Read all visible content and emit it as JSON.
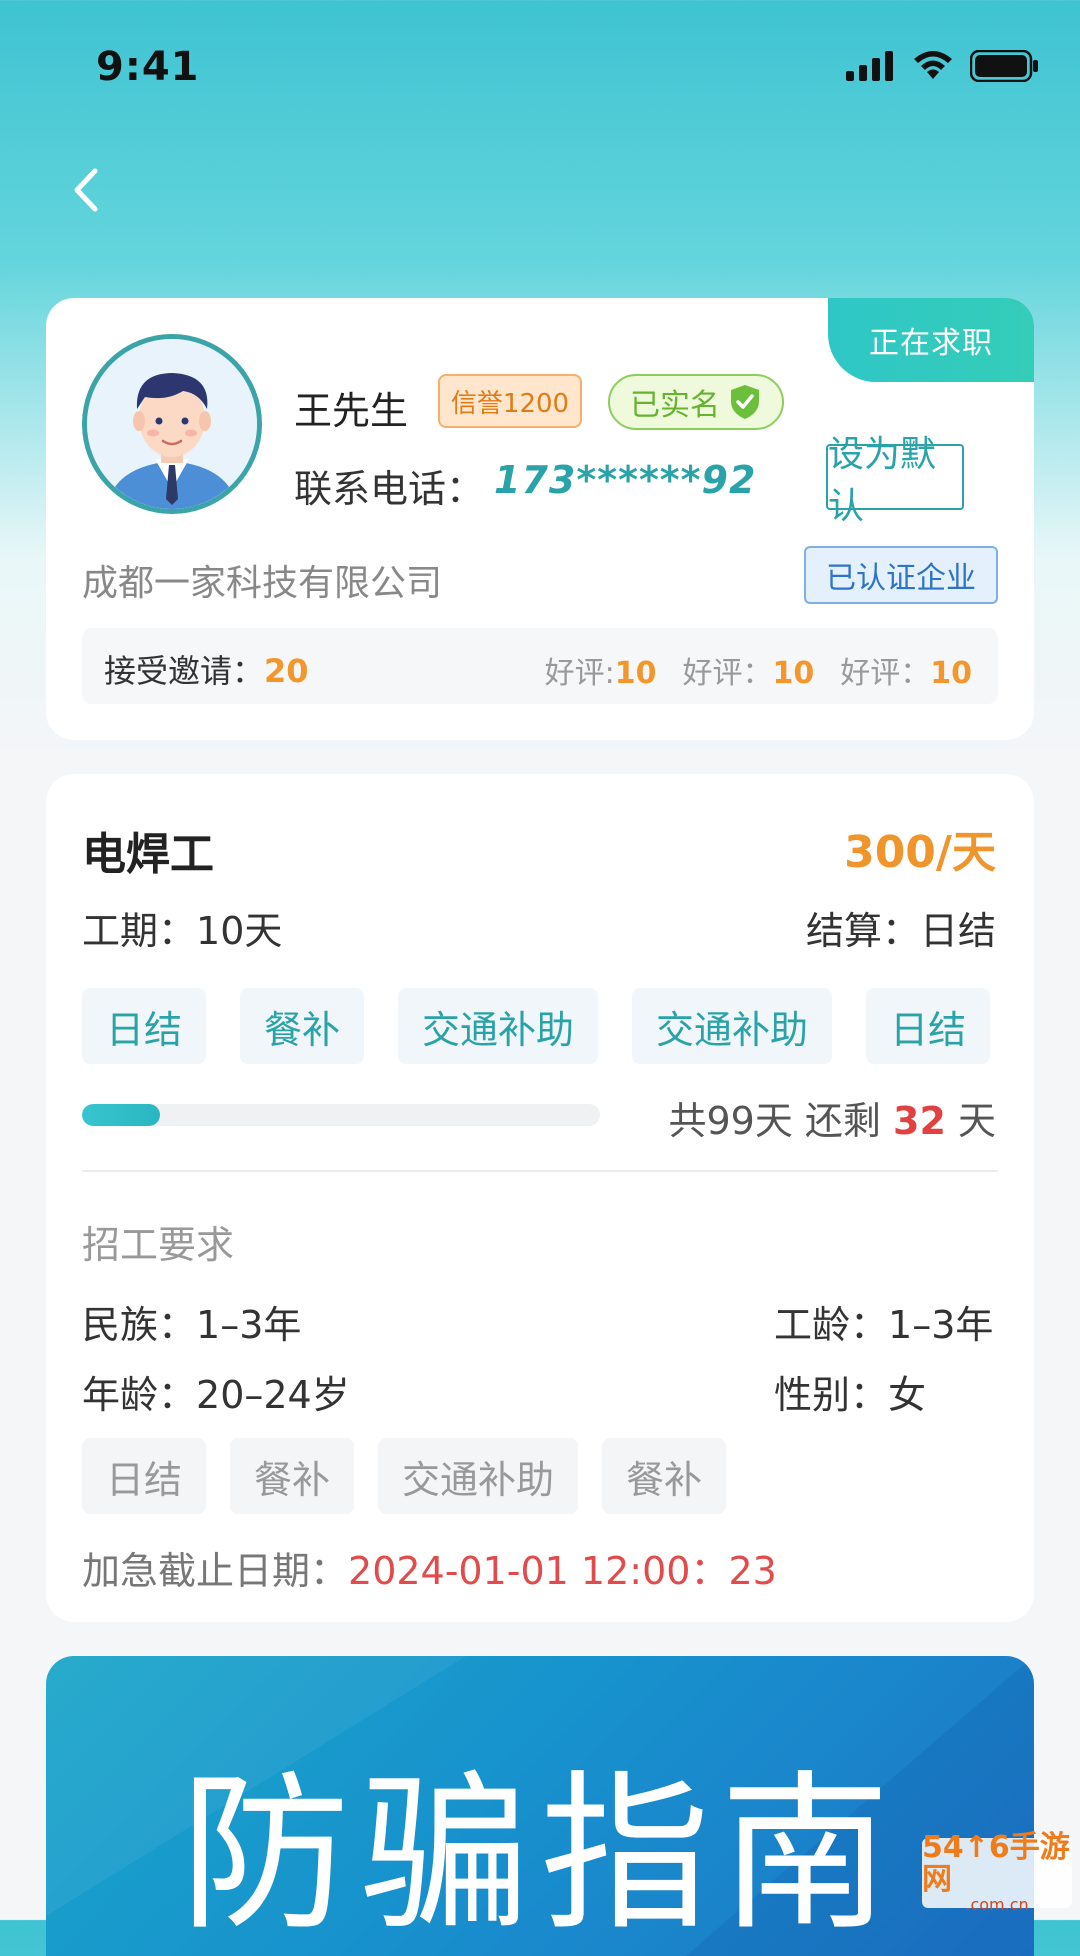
{
  "status_bar": {
    "time": "9:41"
  },
  "profile": {
    "status_tag": "正在求职",
    "name": "王先生",
    "credit_badge": "信誉1200",
    "verified_badge": "已实名",
    "phone_label": "联系电话：",
    "phone_value": "173******92",
    "default_button": "设为默认",
    "company": "成都一家科技有限公司",
    "company_badge": "已认证企业",
    "stats": {
      "accept_label": "接受邀请：",
      "accept_value": "20",
      "reviews": [
        {
          "label": "好评:",
          "value": "10"
        },
        {
          "label": "好评：",
          "value": "10"
        },
        {
          "label": "好评：",
          "value": "10"
        }
      ]
    }
  },
  "job": {
    "title": "电焊工",
    "wage": "300/天",
    "period_label": "工期：",
    "period_value": "10天",
    "settle_label": "结算：",
    "settle_value": "日结",
    "tags": [
      "日结",
      "餐补",
      "交通补助",
      "交通补助",
      "日结"
    ],
    "progress": {
      "fraction": 0.15,
      "total_text": "共99天 还剩 ",
      "remaining": "32",
      "unit": " 天"
    },
    "requirements_title": "招工要求",
    "requirements": {
      "ethnicity_label": "民族：",
      "ethnicity_value": "1–3年",
      "seniority_label": "工龄：",
      "seniority_value": "1–3年",
      "age_label": "年龄：",
      "age_value": "20–24岁",
      "gender_label": "性别：",
      "gender_value": "女"
    },
    "req_tags": [
      "日结",
      "餐补",
      "交通补助",
      "餐补"
    ],
    "deadline_label": "加急截止日期：",
    "deadline_value": "2024-01-01 12:00：23"
  },
  "banner": {
    "text": "防骗指南"
  },
  "watermark": {
    "top": "54↑6手游网",
    "bottom": ".com.cn"
  },
  "colors": {
    "accent": "#2aa3a8",
    "orange": "#f0952b",
    "red": "#e24141"
  },
  "icons": [
    "back-chevron-icon",
    "signal-icon",
    "wifi-icon",
    "battery-icon",
    "shield-check-icon"
  ]
}
